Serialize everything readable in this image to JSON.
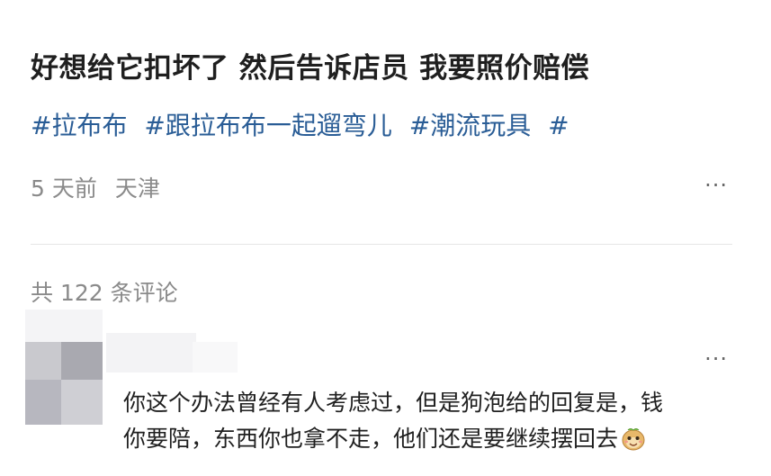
{
  "post": {
    "title": "好想给它扣坏了 然后告诉店员 我要照价赔偿",
    "tags": [
      "#拉布布",
      "#跟拉布布一起遛弯儿",
      "#潮流玩具",
      "#"
    ],
    "time": "5 天前",
    "location": "天津",
    "more_label": "···"
  },
  "comments": {
    "count_label": "共 122 条评论",
    "items": [
      {
        "text_line1": "你这个办法曾经有人考虑过，但是狗泡给的回复是，钱",
        "text_line2": "你要陪，东西你也拿不走，他们还是要继续摆回去",
        "emoji": "monkey-face-emoji",
        "more_label": "···"
      }
    ]
  },
  "colors": {
    "tag": "#2a5d96",
    "meta": "#8a8a8a",
    "title": "#1f1f1f",
    "divider": "#e6e6e6"
  }
}
